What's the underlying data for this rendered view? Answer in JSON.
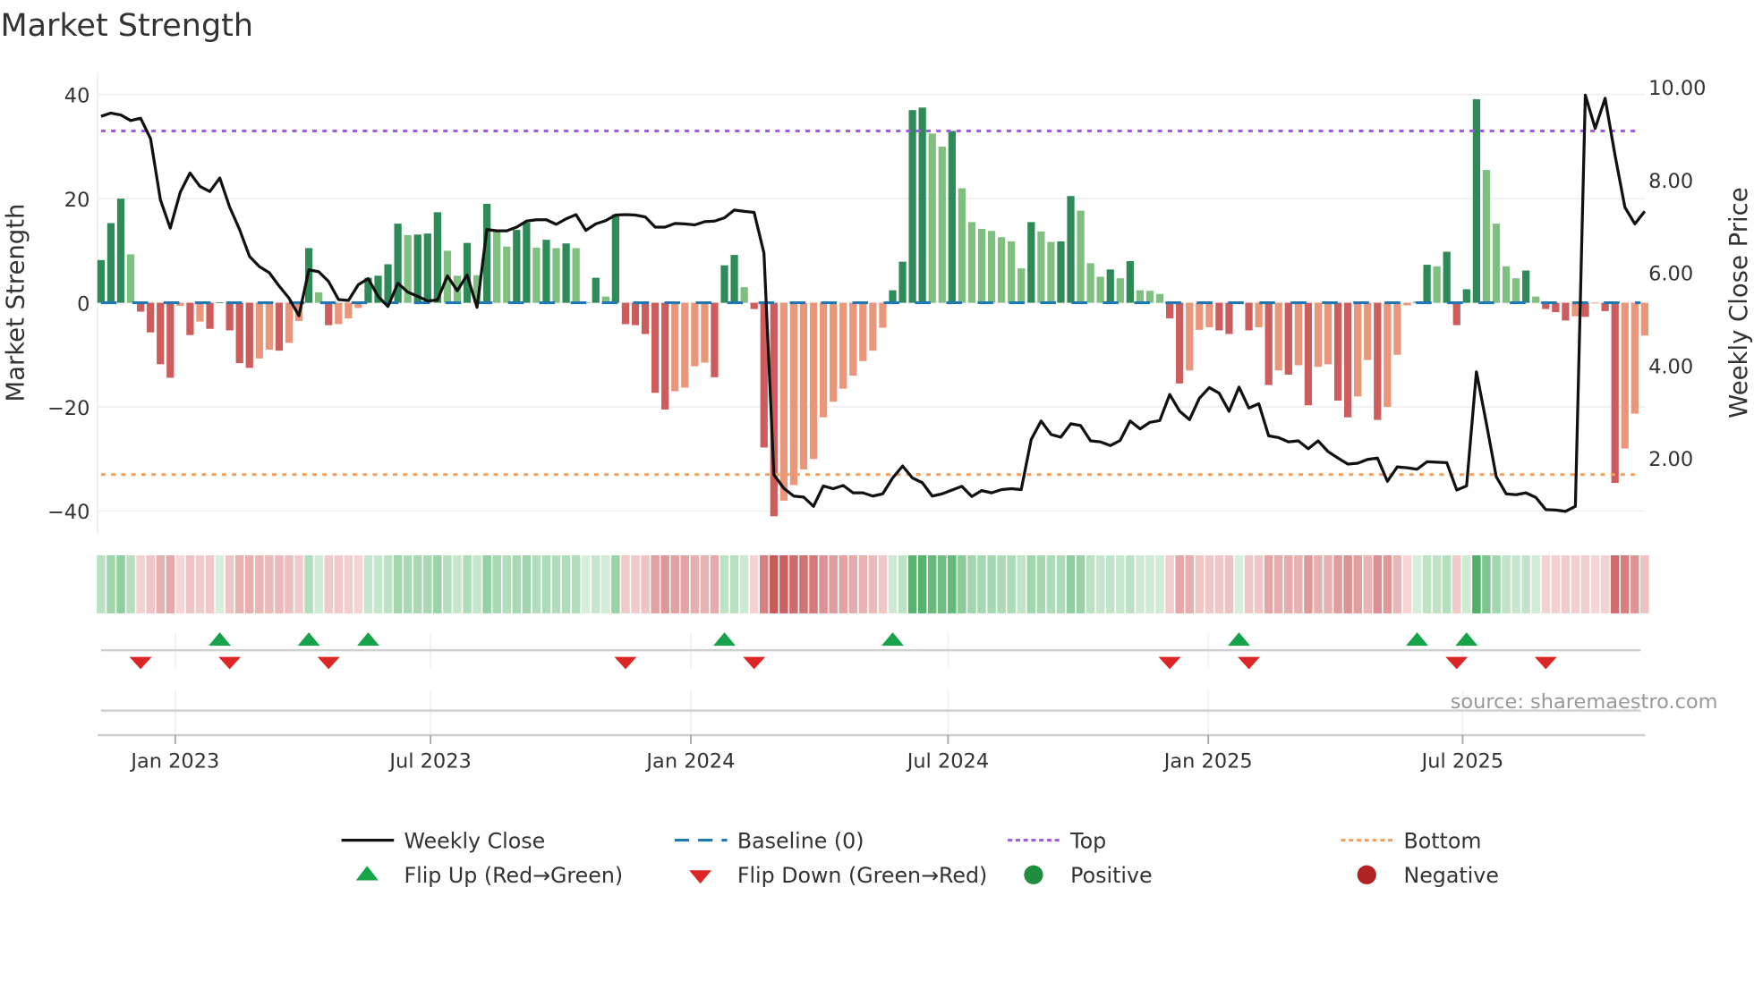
{
  "chart_data": {
    "type": "bar",
    "title": "Market Strength",
    "ylabel": "Market Strength",
    "y2label": "Weekly Close Price",
    "ylim": [
      -45,
      45
    ],
    "y_ticks": [
      40,
      20,
      0,
      -20,
      -40
    ],
    "y_tick_labels": [
      "40",
      "20",
      "0",
      "−20",
      "−40"
    ],
    "y2_ticks": [
      10,
      8,
      6,
      4,
      2
    ],
    "y2_tick_labels": [
      "10.00",
      "8.00",
      "6.00",
      "4.00",
      "2.00"
    ],
    "x_tick_week_index": [
      7.5,
      33.3,
      59.6,
      85.6,
      111.9,
      137.6
    ],
    "x_tick_labels": [
      "Jan 2023",
      "Jul 2023",
      "Jan 2024",
      "Jul 2024",
      "Jan 2025",
      "Jul 2025"
    ],
    "top_level": 33,
    "bottom_level": -33,
    "baseline": 0,
    "strength": [
      8.2,
      15.3,
      20,
      9.3,
      -1.7,
      -5.7,
      -11.8,
      -14.4,
      -0.6,
      -6.2,
      -3.6,
      -5,
      0.1,
      -5.3,
      -11.6,
      -12.5,
      -10.7,
      -9,
      -9.2,
      -7.7,
      -3.5,
      10.5,
      2,
      -4.3,
      -4.1,
      -3,
      -1,
      4.8,
      5.2,
      7.4,
      15.2,
      13,
      13.1,
      13.3,
      17.4,
      10,
      5.2,
      11.5,
      5.3,
      19,
      13.9,
      10.8,
      14,
      15.4,
      10.6,
      12.1,
      10.5,
      11.4,
      10.5,
      0.1,
      4.8,
      1.2,
      17,
      -4.1,
      -4.3,
      -6,
      -17.3,
      -20.5,
      -17,
      -16.3,
      -12.2,
      -11.5,
      -14.3,
      7.2,
      9.2,
      3,
      -1.2,
      -27.8,
      -41,
      -38,
      -35,
      -32,
      -30,
      -22,
      -19,
      -16.5,
      -14,
      -11.2,
      -9.2,
      -4.8,
      2.4,
      7.9,
      37,
      37.5,
      32.5,
      30,
      33,
      22,
      15.5,
      14.2,
      13.8,
      12.6,
      11.8,
      6.6,
      15.5,
      13.7,
      11.7,
      11.8,
      20.5,
      17.7,
      7.6,
      5,
      6.4,
      4.7,
      8,
      2.4,
      2.3,
      1.7,
      -3,
      -15.5,
      -13,
      -5.2,
      -4.7,
      -5.3,
      -6,
      0.1,
      -5.3,
      -4.7,
      -15.8,
      -13,
      -13.8,
      -12,
      -19.7,
      -12.3,
      -11.8,
      -18.8,
      -22,
      -18,
      -11,
      -22.5,
      -20,
      -10,
      -0.5,
      0.2,
      7.3,
      7,
      9.8,
      -4.3,
      2.6,
      39.1,
      25.5,
      15.2,
      7,
      4.7,
      6.2,
      1.2,
      -1.2,
      -1.8,
      -3.4,
      -2.6,
      -2.7,
      -0.1,
      -1.6,
      -34.6,
      -28,
      -21.3,
      -6.3
    ],
    "close": [
      9.37,
      9.44,
      9.4,
      9.28,
      9.33,
      8.89,
      7.57,
      6.96,
      7.73,
      8.15,
      7.86,
      7.75,
      8.04,
      7.41,
      6.93,
      6.35,
      6.13,
      6.0,
      5.71,
      5.45,
      5.07,
      6.06,
      6.02,
      5.81,
      5.42,
      5.4,
      5.74,
      5.87,
      5.49,
      5.27,
      5.77,
      5.58,
      5.49,
      5.39,
      5.41,
      5.93,
      5.61,
      5.95,
      5.25,
      6.93,
      6.9,
      6.9,
      6.98,
      7.11,
      7.14,
      7.14,
      7.04,
      7.16,
      7.25,
      6.91,
      7.05,
      7.12,
      7.24,
      7.25,
      7.24,
      7.2,
      6.98,
      6.98,
      7.06,
      7.05,
      7.03,
      7.1,
      7.11,
      7.18,
      7.35,
      7.32,
      7.3,
      6.42,
      1.64,
      1.35,
      1.18,
      1.16,
      0.96,
      1.4,
      1.34,
      1.41,
      1.25,
      1.25,
      1.18,
      1.23,
      1.57,
      1.83,
      1.57,
      1.47,
      1.18,
      1.23,
      1.31,
      1.39,
      1.17,
      1.3,
      1.25,
      1.32,
      1.34,
      1.32,
      2.4,
      2.8,
      2.51,
      2.45,
      2.74,
      2.7,
      2.37,
      2.35,
      2.27,
      2.38,
      2.8,
      2.63,
      2.77,
      2.81,
      3.37,
      3.01,
      2.83,
      3.29,
      3.52,
      3.4,
      3.01,
      3.53,
      3.08,
      3.17,
      2.48,
      2.44,
      2.35,
      2.37,
      2.2,
      2.37,
      2.14,
      2.0,
      1.87,
      1.89,
      1.97,
      2.0,
      1.5,
      1.81,
      1.79,
      1.76,
      1.92,
      1.91,
      1.9,
      1.31,
      1.4,
      3.86,
      2.75,
      1.6,
      1.23,
      1.21,
      1.25,
      1.15,
      0.89,
      0.88,
      0.85,
      0.96,
      9.83,
      9.11,
      9.76,
      8.54,
      7.41,
      7.05,
      7.32
    ],
    "flip_up_week_index": [
      12,
      21,
      27,
      63,
      80,
      115,
      133,
      138
    ],
    "flip_down_week_index": [
      4,
      13,
      23,
      53,
      66,
      108,
      116,
      137,
      146
    ],
    "legend": {
      "placement": "bottom",
      "items": [
        {
          "label": "Weekly Close",
          "kind": "line",
          "color": "#111111"
        },
        {
          "label": "Baseline (0)",
          "kind": "dash",
          "color": "#1f77b4"
        },
        {
          "label": "Top",
          "kind": "dot",
          "color": "#9b5de5"
        },
        {
          "label": "Bottom",
          "kind": "dot",
          "color": "#f4a261"
        },
        {
          "label": "Flip Up (Red→Green)",
          "kind": "up",
          "color": "#16a34a"
        },
        {
          "label": "Flip Down (Green→Red)",
          "kind": "down",
          "color": "#dc2626"
        },
        {
          "label": "Positive",
          "kind": "circle",
          "color": "#1e8e3e"
        },
        {
          "label": "Negative",
          "kind": "circle",
          "color": "#b22222"
        }
      ]
    },
    "colors": {
      "up_strong": "#2e8b57",
      "up_weak": "#7fbf7f",
      "down_strong": "#cd5c5c",
      "down_weak": "#e9967a"
    }
  },
  "source": "source: sharemaestro.com"
}
